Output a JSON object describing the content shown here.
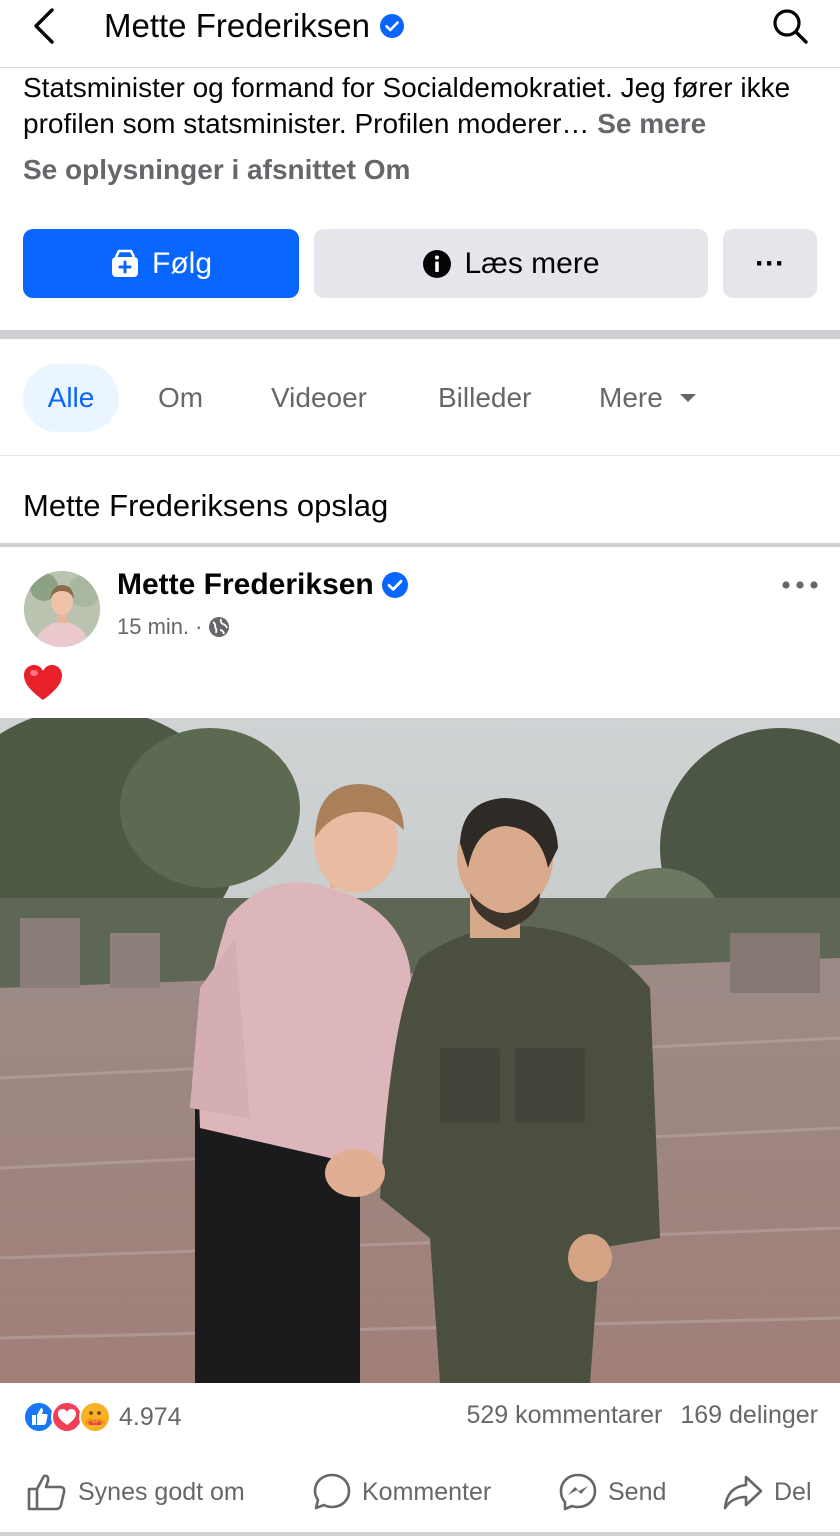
{
  "header": {
    "title": "Mette Frederiksen",
    "back_icon": "back-arrow-icon",
    "search_icon": "search-icon",
    "verified_color": "#0866ff"
  },
  "bio": {
    "text": "Statsminister og formand for Socialdemokratiet. Jeg fører ikke profilen som statsminister. Profilen moderer…",
    "see_more": "Se mere",
    "about_link": "Se oplysninger i afsnittet Om"
  },
  "buttons": {
    "follow": "Følg",
    "read_more": "Læs mere",
    "more": "···"
  },
  "tabs": [
    {
      "label": "Alle",
      "active": true
    },
    {
      "label": "Om"
    },
    {
      "label": "Videoer"
    },
    {
      "label": "Billeder"
    },
    {
      "label": "Mere"
    }
  ],
  "section_title": "Mette Frederiksens opslag",
  "post": {
    "author": "Mette Frederiksen",
    "time": "15 min.",
    "separator": "·",
    "audience_icon": "globe-icon",
    "body_emoji": "heart-icon",
    "reactions": {
      "icons": [
        "like-icon",
        "love-icon",
        "care-icon"
      ],
      "count": "4.974"
    },
    "comments": "529 kommentarer",
    "shares": "169 delinger",
    "actions": {
      "like": "Synes godt om",
      "comment": "Kommenter",
      "send": "Send",
      "share": "Del"
    }
  },
  "colors": {
    "accent": "#0866ff",
    "secondary_text": "#65676b",
    "button_gray": "#e4e6eb",
    "divider": "#ced0d4"
  }
}
